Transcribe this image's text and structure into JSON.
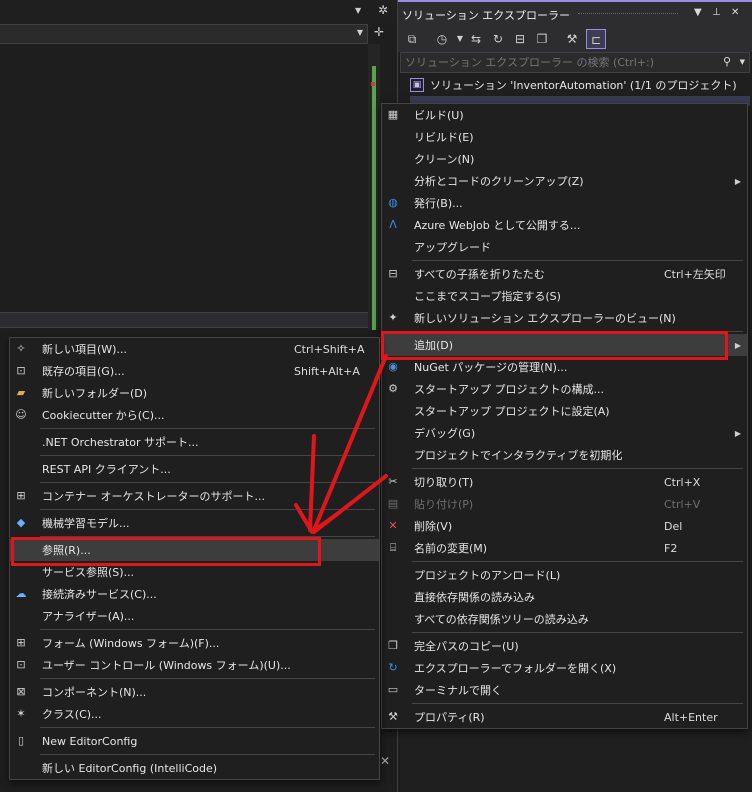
{
  "solution_explorer": {
    "title": "ソリューション エクスプローラー",
    "search_placeholder": "ソリューション エクスプローラー の検索 (Ctrl+:)",
    "solution_row": "ソリューション 'InventorAutomation' (1/1 のプロジェクト)",
    "title_icons": [
      "chevron-down-icon",
      "pin-icon",
      "close-icon"
    ],
    "toolbar_icons": [
      "vs-solution-icon",
      "history-icon",
      "chevron-down-icon",
      "sync-icon",
      "refresh-icon",
      "collapse-all-icon",
      "show-all-files-icon",
      "properties-wrench-icon",
      "preview-selected-icon"
    ]
  },
  "context_menu_main": {
    "items": [
      {
        "icon": "build-icon",
        "label": "ビルド(U)",
        "shortcut": "",
        "submenu": false
      },
      {
        "icon": "",
        "label": "リビルド(E)",
        "shortcut": "",
        "submenu": false
      },
      {
        "icon": "",
        "label": "クリーン(N)",
        "shortcut": "",
        "submenu": false
      },
      {
        "icon": "",
        "label": "分析とコードのクリーンアップ(Z)",
        "shortcut": "",
        "submenu": true
      },
      {
        "icon": "globe-publish-icon",
        "label": "発行(B)...",
        "shortcut": "",
        "submenu": false
      },
      {
        "icon": "azure-icon",
        "label": "Azure WebJob として公開する...",
        "shortcut": "",
        "submenu": false
      },
      {
        "icon": "",
        "label": "アップグレード",
        "shortcut": "",
        "submenu": false
      },
      {
        "icon": "collapse-icon",
        "label": "すべての子孫を折りたたむ",
        "shortcut": "Ctrl+左矢印",
        "submenu": false
      },
      {
        "icon": "",
        "label": "ここまでスコープ指定する(S)",
        "shortcut": "",
        "submenu": false
      },
      {
        "icon": "new-view-icon",
        "label": "新しいソリューション エクスプローラーのビュー(N)",
        "shortcut": "",
        "submenu": false
      },
      {
        "icon": "",
        "label": "追加(D)",
        "shortcut": "",
        "submenu": true
      },
      {
        "icon": "nuget-icon",
        "label": "NuGet パッケージの管理(N)...",
        "shortcut": "",
        "submenu": false
      },
      {
        "icon": "gear-icon",
        "label": "スタートアップ プロジェクトの構成...",
        "shortcut": "",
        "submenu": false
      },
      {
        "icon": "",
        "label": "スタートアップ プロジェクトに設定(A)",
        "shortcut": "",
        "submenu": false
      },
      {
        "icon": "",
        "label": "デバッグ(G)",
        "shortcut": "",
        "submenu": true
      },
      {
        "icon": "",
        "label": "プロジェクトでインタラクティブを初期化",
        "shortcut": "",
        "submenu": false
      },
      {
        "icon": "cut-icon",
        "label": "切り取り(T)",
        "shortcut": "Ctrl+X",
        "submenu": false
      },
      {
        "icon": "paste-icon",
        "label": "貼り付け(P)",
        "shortcut": "Ctrl+V",
        "submenu": false,
        "disabled": true
      },
      {
        "icon": "delete-icon",
        "label": "削除(V)",
        "shortcut": "Del",
        "submenu": false
      },
      {
        "icon": "rename-icon",
        "label": "名前の変更(M)",
        "shortcut": "F2",
        "submenu": false
      },
      {
        "icon": "",
        "label": "プロジェクトのアンロード(L)",
        "shortcut": "",
        "submenu": false
      },
      {
        "icon": "",
        "label": "直接依存関係の読み込み",
        "shortcut": "",
        "submenu": false
      },
      {
        "icon": "",
        "label": "すべての依存関係ツリーの読み込み",
        "shortcut": "",
        "submenu": false
      },
      {
        "icon": "copy-icon",
        "label": "完全パスのコピー(U)",
        "shortcut": "",
        "submenu": false
      },
      {
        "icon": "open-folder-icon",
        "label": "エクスプローラーでフォルダーを開く(X)",
        "shortcut": "",
        "submenu": false
      },
      {
        "icon": "terminal-icon",
        "label": "ターミナルで開く",
        "shortcut": "",
        "submenu": false
      },
      {
        "icon": "wrench-icon",
        "label": "プロパティ(R)",
        "shortcut": "Alt+Enter",
        "submenu": false
      }
    ]
  },
  "context_menu_add": {
    "items": [
      {
        "icon": "new-item-icon",
        "label": "新しい項目(W)...",
        "shortcut": "Ctrl+Shift+A"
      },
      {
        "icon": "existing-item-icon",
        "label": "既存の項目(G)...",
        "shortcut": "Shift+Alt+A"
      },
      {
        "icon": "new-folder-icon",
        "label": "新しいフォルダー(D)",
        "shortcut": ""
      },
      {
        "icon": "cookiecutter-icon",
        "label": "Cookiecutter から(C)...",
        "shortcut": ""
      },
      {
        "icon": "",
        "label": ".NET Orchestrator サポート...",
        "shortcut": ""
      },
      {
        "icon": "",
        "label": "REST API クライアント...",
        "shortcut": ""
      },
      {
        "icon": "container-icon",
        "label": "コンテナー オーケストレーターのサポート...",
        "shortcut": ""
      },
      {
        "icon": "ml-model-icon",
        "label": "機械学習モデル...",
        "shortcut": ""
      },
      {
        "icon": "",
        "label": "参照(R)...",
        "shortcut": ""
      },
      {
        "icon": "",
        "label": "サービス参照(S)...",
        "shortcut": ""
      },
      {
        "icon": "connected-service-icon",
        "label": "接続済みサービス(C)...",
        "shortcut": ""
      },
      {
        "icon": "",
        "label": "アナライザー(A)...",
        "shortcut": ""
      },
      {
        "icon": "windows-form-icon",
        "label": "フォーム (Windows フォーム)(F)...",
        "shortcut": ""
      },
      {
        "icon": "user-control-icon",
        "label": "ユーザー コントロール (Windows フォーム)(U)...",
        "shortcut": ""
      },
      {
        "icon": "component-icon",
        "label": "コンポーネント(N)...",
        "shortcut": ""
      },
      {
        "icon": "class-icon",
        "label": "クラス(C)...",
        "shortcut": ""
      },
      {
        "icon": "editorconfig-icon",
        "label": "New EditorConfig",
        "shortcut": ""
      },
      {
        "icon": "",
        "label": "新しい EditorConfig (IntelliCode)",
        "shortcut": ""
      }
    ]
  },
  "colors": {
    "annotation_red": "#e0161b",
    "accent_purple": "#9d8ce6"
  }
}
